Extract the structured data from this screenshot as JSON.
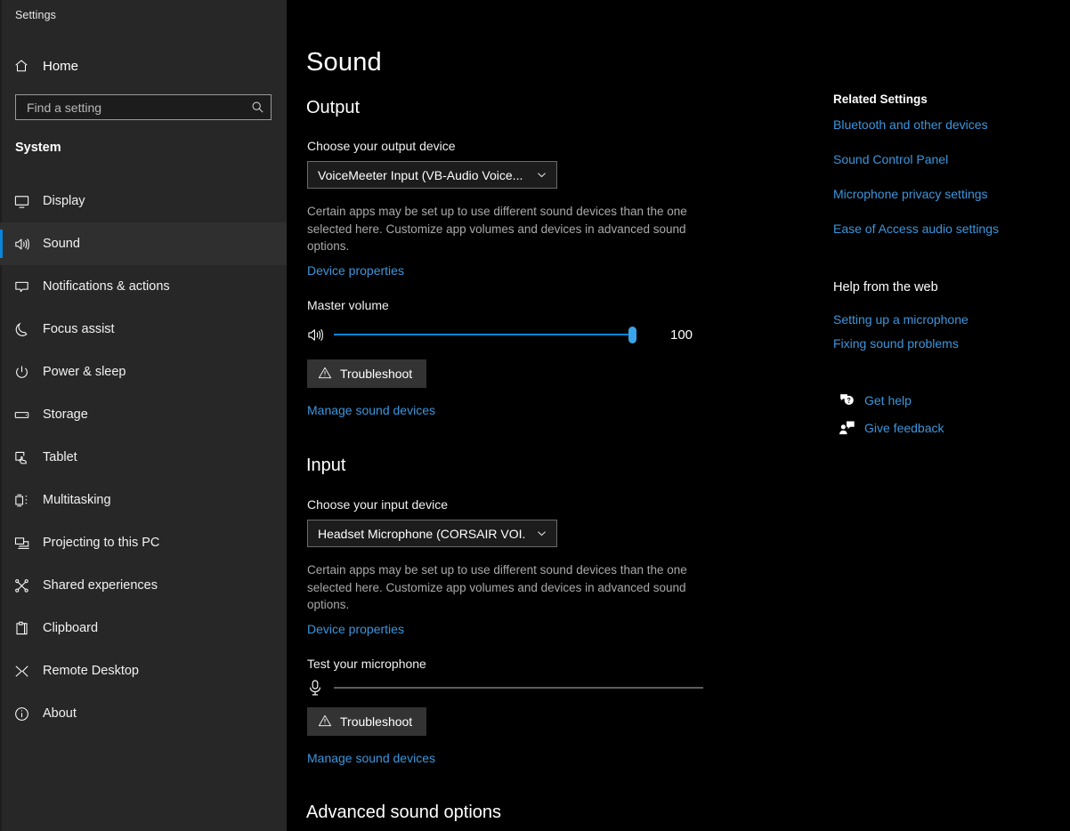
{
  "window": {
    "title": "Settings",
    "controls": [
      {
        "name": "minimize",
        "glyph": "—"
      },
      {
        "name": "maximize",
        "glyph": "□"
      },
      {
        "name": "close",
        "glyph": "✕"
      }
    ]
  },
  "sidebar": {
    "home_label": "Home",
    "search_placeholder": "Find a setting",
    "section_title": "System",
    "accent_color": "#0a84d8",
    "items": [
      {
        "label": "Display",
        "icon": "monitor-icon",
        "selected": false
      },
      {
        "label": "Sound",
        "icon": "speaker-icon",
        "selected": true
      },
      {
        "label": "Notifications & actions",
        "icon": "notification-icon",
        "selected": false
      },
      {
        "label": "Focus assist",
        "icon": "moon-icon",
        "selected": false
      },
      {
        "label": "Power & sleep",
        "icon": "power-icon",
        "selected": false
      },
      {
        "label": "Storage",
        "icon": "storage-icon",
        "selected": false
      },
      {
        "label": "Tablet",
        "icon": "tablet-icon",
        "selected": false
      },
      {
        "label": "Multitasking",
        "icon": "multitasking-icon",
        "selected": false
      },
      {
        "label": "Projecting to this PC",
        "icon": "projecting-icon",
        "selected": false
      },
      {
        "label": "Shared experiences",
        "icon": "shared-icon",
        "selected": false
      },
      {
        "label": "Clipboard",
        "icon": "clipboard-icon",
        "selected": false
      },
      {
        "label": "Remote Desktop",
        "icon": "remote-desktop-icon",
        "selected": false
      },
      {
        "label": "About",
        "icon": "info-icon",
        "selected": false
      }
    ]
  },
  "main": {
    "page_title": "Sound",
    "output": {
      "heading": "Output",
      "device_label": "Choose your output device",
      "device_value": "VoiceMeeter Input (VB-Audio Voice...",
      "note": "Certain apps may be set up to use different sound devices than the one selected here. Customize app volumes and devices in advanced sound options.",
      "device_properties_link": "Device properties",
      "volume_label": "Master volume",
      "volume_value": "100",
      "volume_percent": 100,
      "troubleshoot_label": "Troubleshoot",
      "manage_link": "Manage sound devices"
    },
    "input": {
      "heading": "Input",
      "device_label": "Choose your input device",
      "device_value": "Headset Microphone (CORSAIR VOI...",
      "note": "Certain apps may be set up to use different sound devices than the one selected here. Customize app volumes and devices in advanced sound options.",
      "device_properties_link": "Device properties",
      "test_label": "Test your microphone",
      "test_level_percent": 0,
      "troubleshoot_label": "Troubleshoot",
      "manage_link": "Manage sound devices"
    },
    "advanced_heading": "Advanced sound options"
  },
  "right_panel": {
    "related_heading": "Related Settings",
    "related_links": [
      "Bluetooth and other devices",
      "Sound Control Panel",
      "Microphone privacy settings",
      "Ease of Access audio settings"
    ],
    "help_heading": "Help from the web",
    "help_links": [
      "Setting up a microphone",
      "Fixing sound problems"
    ],
    "get_help_label": "Get help",
    "give_feedback_label": "Give feedback",
    "link_color": "#3b96dd"
  }
}
